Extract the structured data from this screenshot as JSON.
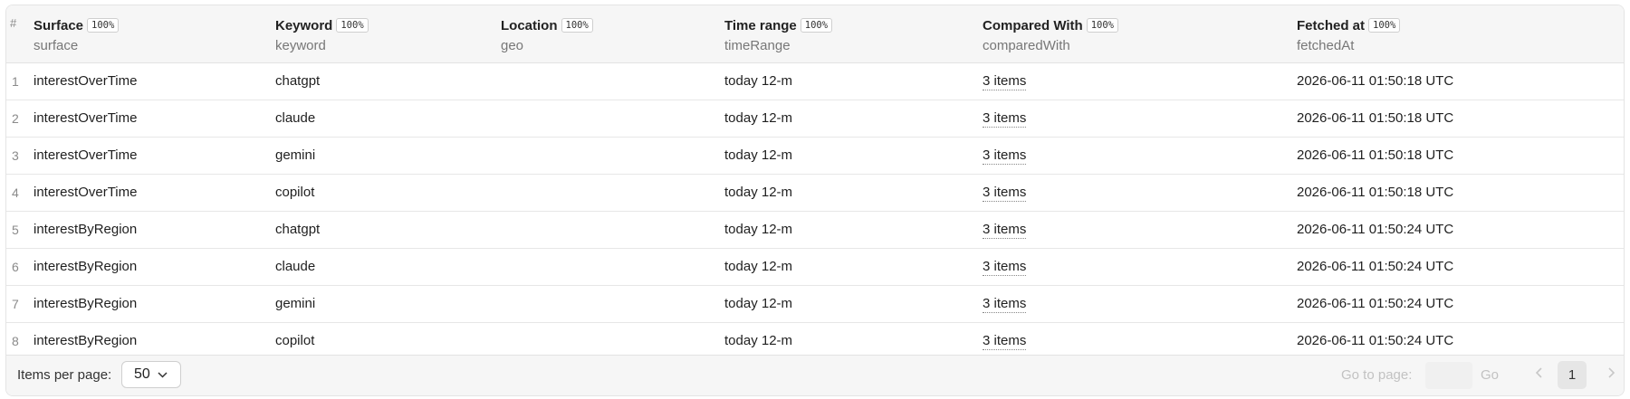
{
  "table": {
    "index_header": "#",
    "columns": [
      {
        "label": "Surface",
        "badge": "100%",
        "key": "surface"
      },
      {
        "label": "Keyword",
        "badge": "100%",
        "key": "keyword"
      },
      {
        "label": "Location",
        "badge": "100%",
        "key": "geo"
      },
      {
        "label": "Time range",
        "badge": "100%",
        "key": "timeRange"
      },
      {
        "label": "Compared With",
        "badge": "100%",
        "key": "comparedWith"
      },
      {
        "label": "Fetched at",
        "badge": "100%",
        "key": "fetchedAt"
      }
    ],
    "rows": [
      {
        "index": "1",
        "surface": "interestOverTime",
        "keyword": "chatgpt",
        "geo": "",
        "timeRange": "today 12-m",
        "comparedWith": "3 items",
        "fetchedAt": "2026-06-11 01:50:18 UTC"
      },
      {
        "index": "2",
        "surface": "interestOverTime",
        "keyword": "claude",
        "geo": "",
        "timeRange": "today 12-m",
        "comparedWith": "3 items",
        "fetchedAt": "2026-06-11 01:50:18 UTC"
      },
      {
        "index": "3",
        "surface": "interestOverTime",
        "keyword": "gemini",
        "geo": "",
        "timeRange": "today 12-m",
        "comparedWith": "3 items",
        "fetchedAt": "2026-06-11 01:50:18 UTC"
      },
      {
        "index": "4",
        "surface": "interestOverTime",
        "keyword": "copilot",
        "geo": "",
        "timeRange": "today 12-m",
        "comparedWith": "3 items",
        "fetchedAt": "2026-06-11 01:50:18 UTC"
      },
      {
        "index": "5",
        "surface": "interestByRegion",
        "keyword": "chatgpt",
        "geo": "",
        "timeRange": "today 12-m",
        "comparedWith": "3 items",
        "fetchedAt": "2026-06-11 01:50:24 UTC"
      },
      {
        "index": "6",
        "surface": "interestByRegion",
        "keyword": "claude",
        "geo": "",
        "timeRange": "today 12-m",
        "comparedWith": "3 items",
        "fetchedAt": "2026-06-11 01:50:24 UTC"
      },
      {
        "index": "7",
        "surface": "interestByRegion",
        "keyword": "gemini",
        "geo": "",
        "timeRange": "today 12-m",
        "comparedWith": "3 items",
        "fetchedAt": "2026-06-11 01:50:24 UTC"
      },
      {
        "index": "8",
        "surface": "interestByRegion",
        "keyword": "copilot",
        "geo": "",
        "timeRange": "today 12-m",
        "comparedWith": "3 items",
        "fetchedAt": "2026-06-11 01:50:24 UTC"
      }
    ]
  },
  "footer": {
    "items_per_page_label": "Items per page:",
    "items_per_page_value": "50",
    "go_to_page_label": "Go to page:",
    "go_label": "Go",
    "current_page": "1",
    "icons": {
      "select_chevron": "chevron-down-icon",
      "prev": "chevron-left-icon",
      "next": "chevron-right-icon"
    }
  }
}
